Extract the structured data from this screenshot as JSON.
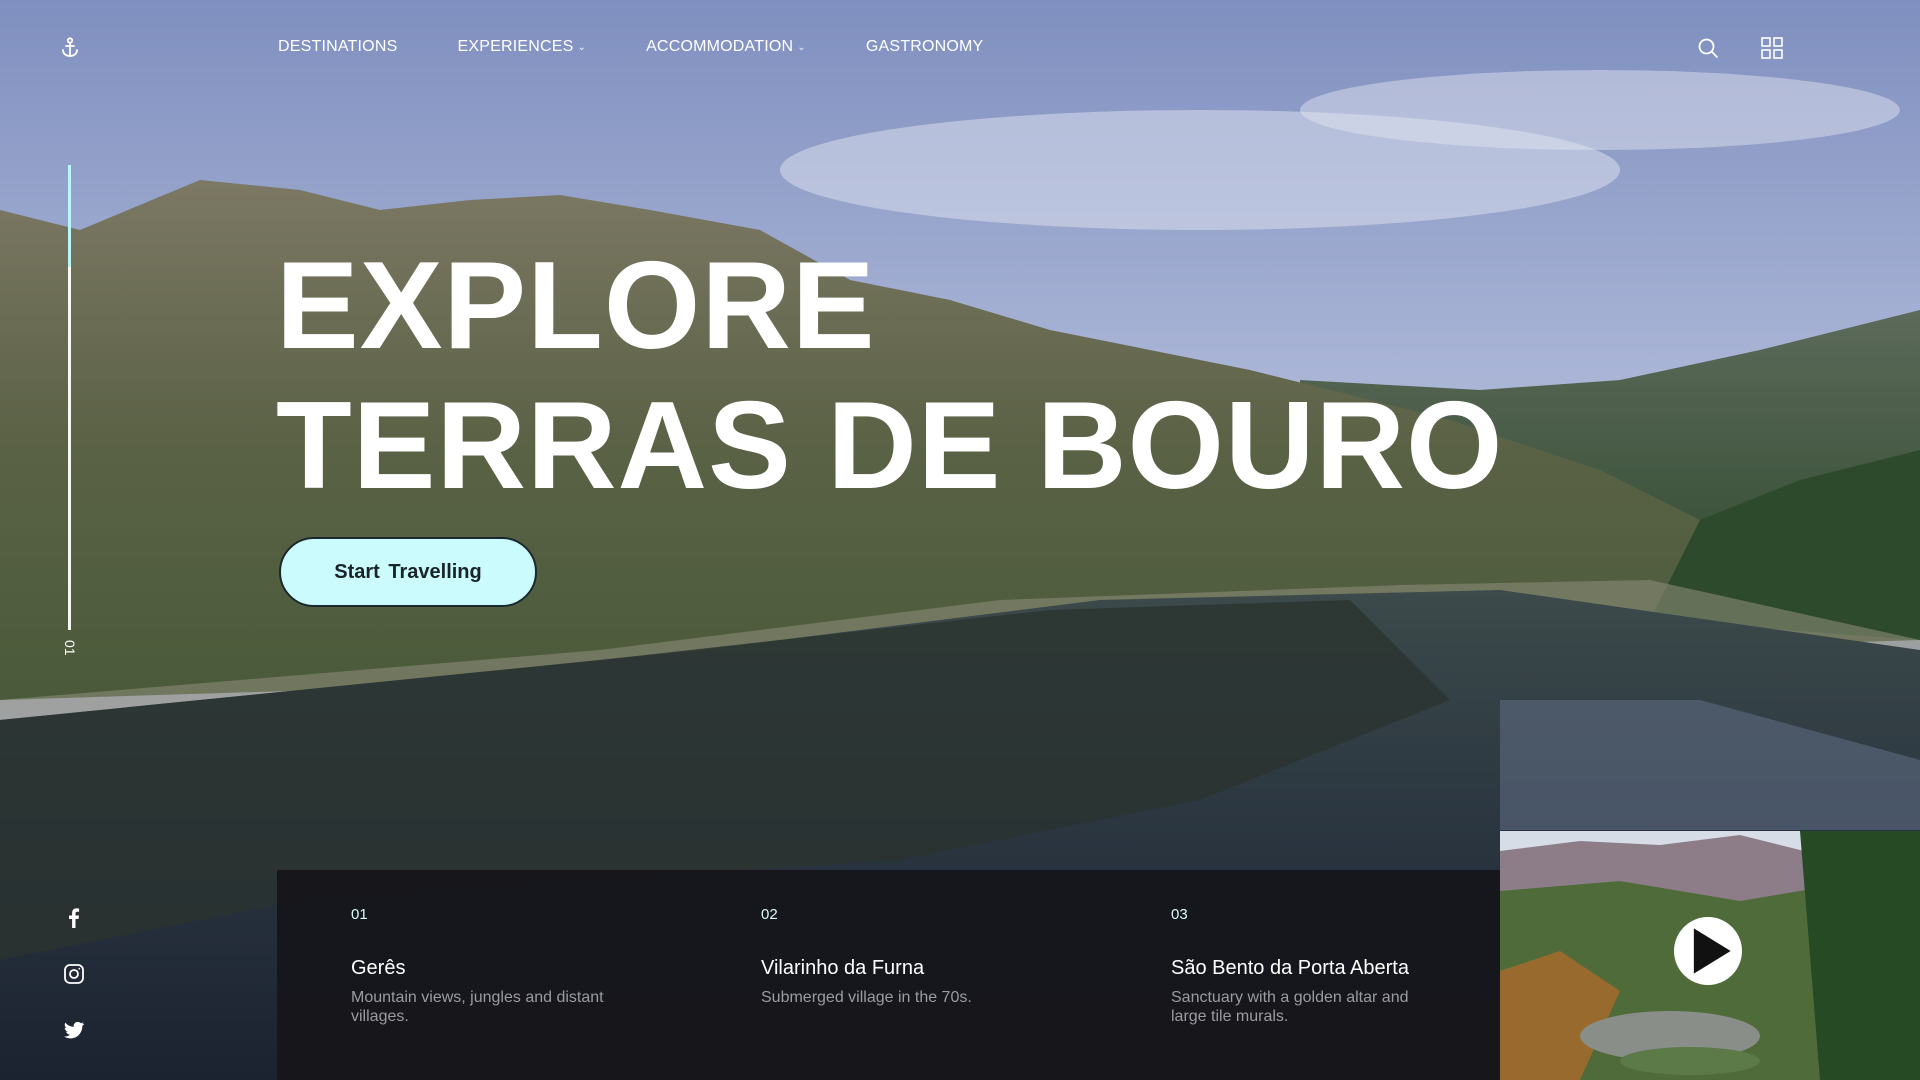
{
  "nav": {
    "logo_icon": "anchor-icon",
    "items": [
      {
        "label": "DESTINATIONS",
        "has_dropdown": false
      },
      {
        "label": "EXPERIENCES",
        "has_dropdown": true
      },
      {
        "label": "ACCOMMODATION",
        "has_dropdown": true
      },
      {
        "label": "GASTRONOMY",
        "has_dropdown": false
      }
    ],
    "icons": [
      "search-icon",
      "grid-menu-icon"
    ]
  },
  "slider": {
    "current": "01",
    "progress": 0.22
  },
  "hero": {
    "title_line1": "EXPLORE",
    "title_line2": "TERRAS DE BOURO",
    "cta_label": "Start  Travelling"
  },
  "socials": [
    "facebook-icon",
    "instagram-icon",
    "twitter-icon"
  ],
  "destinations": [
    {
      "num": "01",
      "name": "Gerês",
      "desc": "Mountain views, jungles and distant villages."
    },
    {
      "num": "02",
      "name": "Vilarinho da Furna",
      "desc": "Submerged village in the 70s."
    },
    {
      "num": "03",
      "name": "São Bento da Porta Aberta",
      "desc": "Sanctuary with a golden altar and large tile murals."
    }
  ],
  "video": {
    "icon": "play-icon"
  },
  "colors": {
    "accent": "#cbfbfc",
    "panel": "#16161a",
    "text": "#ffffff",
    "muted": "#9a9ca2"
  }
}
